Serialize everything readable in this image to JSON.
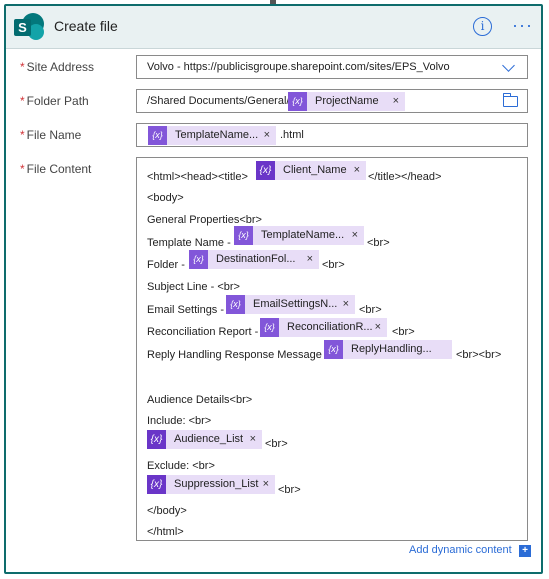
{
  "header": {
    "title": "Create file"
  },
  "fields": {
    "site_address": {
      "label": "Site Address",
      "value": "Volvo - https://publicisgroupe.sharepoint.com/sites/EPS_Volvo"
    },
    "folder_path": {
      "label": "Folder Path",
      "prefix": "/Shared Documents/General/",
      "token": "ProjectName"
    },
    "file_name": {
      "label": "File Name",
      "token": "TemplateName...",
      "suffix": ".html"
    },
    "file_content": {
      "label": "File Content"
    }
  },
  "content": {
    "l1_a": "<html><head><title>",
    "l1_token": "Client_Name",
    "l1_b": "</title></head>",
    "l2": "<body>",
    "l3": "General Properties<br>",
    "l4_a": "Template Name -",
    "l4_token": "TemplateName...",
    "l4_b": "<br>",
    "l5_a": "Folder -",
    "l5_token": "DestinationFol...",
    "l5_b": "<br>",
    "l6": "Subject Line - <br>",
    "l7_a": "Email Settings -",
    "l7_token": "EmailSettingsN...",
    "l7_b": "<br>",
    "l8_a": "Reconciliation Report -",
    "l8_token": "ReconciliationR...",
    "l8_b": "<br>",
    "l9_a": "Reply Handling Response Message -",
    "l9_token": "ReplyHandling...",
    "l9_b": "<br><br>",
    "l10": "Audience Details<br>",
    "l11": "Include: <br>",
    "l12_token": "Audience_List",
    "l12_b": "<br>",
    "l13": "Exclude: <br>",
    "l14_token": "Suppression_List",
    "l14_b": "<br>",
    "l15": "</body>",
    "l16": "</html>"
  },
  "token_icon_text": "{x}",
  "close_glyph": "×",
  "required_mark": "*",
  "add_dynamic_content": "Add dynamic content",
  "add_dynamic_icon": "+",
  "info_glyph": "i",
  "more_glyph": "···",
  "sp_logo_letter": "S",
  "colors": {
    "accent": "#2b6cd6",
    "token_bg": "#e8ddf7",
    "token_icon": "#8256d9",
    "border": "#0e6c6c"
  }
}
